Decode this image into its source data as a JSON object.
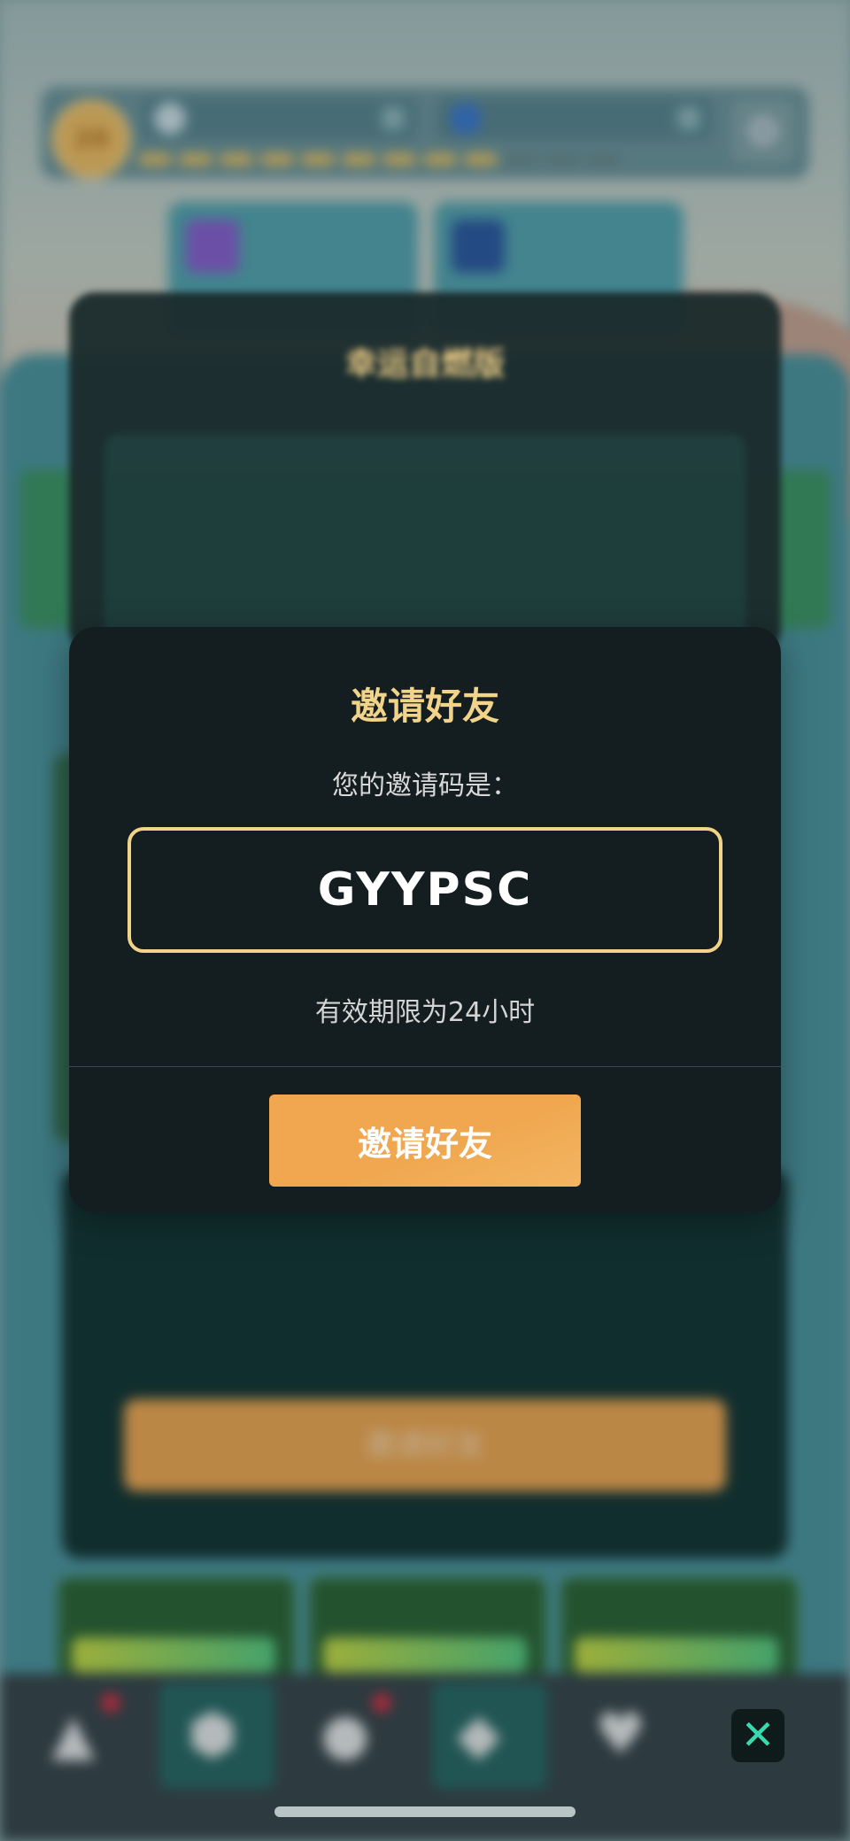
{
  "modal": {
    "title": "邀请好友",
    "subtitle": "您的邀请码是：",
    "code": "GYYPSC",
    "expiry": "有效期限为24小时",
    "button_label": "邀请好友"
  },
  "background": {
    "level": "29",
    "back_modal_title": "幸运自燃版",
    "lower_button_label": "邀请好友",
    "close_icon": "close-icon"
  },
  "colors": {
    "accent_gold": "#f1d38a",
    "button_orange": "#f0a74f",
    "modal_bg": "#141d1f",
    "close_icon_teal": "#39d9ae"
  }
}
